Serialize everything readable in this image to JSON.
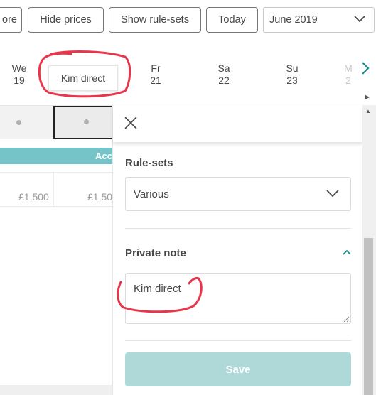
{
  "toolbar": {
    "more_label": "ore",
    "hide_prices_label": "Hide prices",
    "show_rulesets_label": "Show rule-sets",
    "today_label": "Today",
    "month_value": "June 2019"
  },
  "calendar": {
    "days": [
      {
        "name": "We",
        "num": "19"
      },
      {
        "name": "Fr",
        "num": "21"
      },
      {
        "name": "Sa",
        "num": "22"
      },
      {
        "name": "Su",
        "num": "23"
      },
      {
        "name": "M",
        "num": "2"
      }
    ],
    "tooltip": "Kim direct",
    "bar_label": "Acc",
    "prices": [
      "£1,500",
      "£1,50"
    ]
  },
  "panel": {
    "rulesets_label": "Rule-sets",
    "rulesets_value": "Various",
    "private_note_label": "Private note",
    "private_note_value": "Kim direct",
    "save_label": "Save"
  },
  "colors": {
    "accent_teal": "#75c4c8",
    "save_disabled": "#aed9d8",
    "annotation_red": "#e8354a"
  },
  "icons": {
    "close": "close-icon",
    "dropdown": "chevron-down-icon",
    "collapse": "chevron-up-icon",
    "next": "chevron-right-icon"
  }
}
